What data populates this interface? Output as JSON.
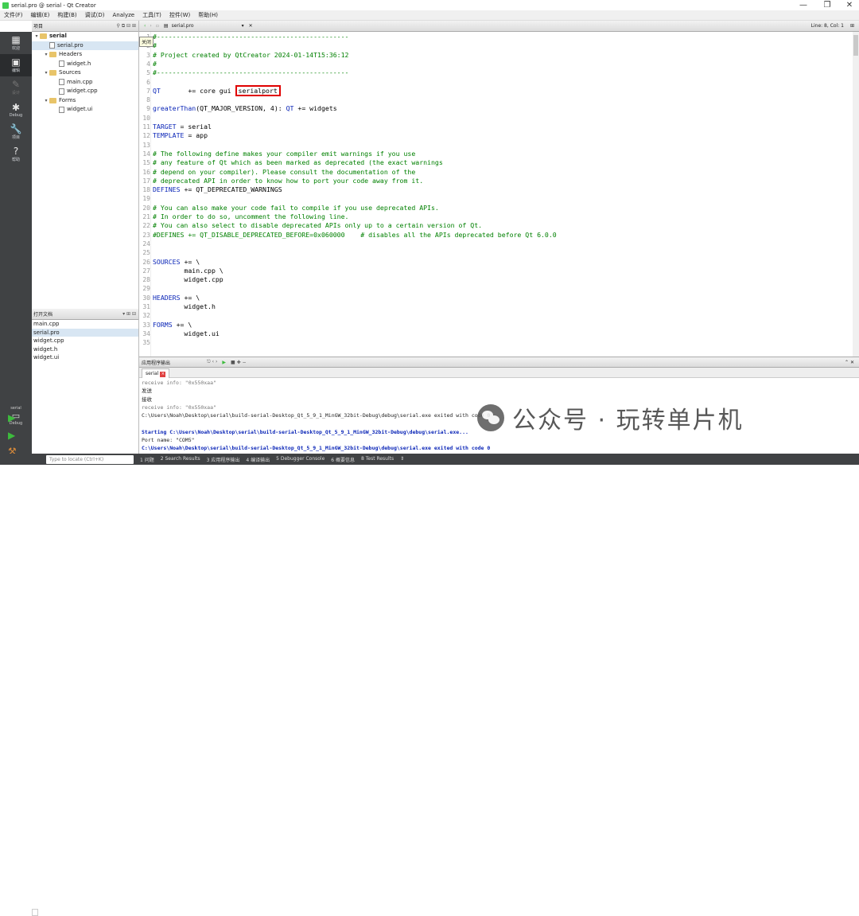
{
  "window": {
    "title": "serial.pro @ serial - Qt Creator",
    "minimize": "—",
    "restore": "❐",
    "close": "✕"
  },
  "menu": [
    "文件(F)",
    "编辑(E)",
    "构建(B)",
    "调试(D)",
    "Analyze",
    "工具(T)",
    "控件(W)",
    "帮助(H)"
  ],
  "modes": [
    {
      "icon": "▦",
      "label": "欢迎"
    },
    {
      "icon": "▣",
      "label": "编辑"
    },
    {
      "icon": "✎",
      "label": "设计"
    },
    {
      "icon": "✱",
      "label": "Debug"
    },
    {
      "icon": "🔧",
      "label": "项目"
    },
    {
      "icon": "?",
      "label": "帮助"
    }
  ],
  "kit": {
    "name": "serial",
    "label": "Debug"
  },
  "project_panel": {
    "header": "项目"
  },
  "tree": [
    {
      "label": "serial",
      "level": 0,
      "arrow": "▾",
      "folder": true,
      "bold": true
    },
    {
      "label": "serial.pro",
      "level": 1,
      "arrow": "",
      "folder": false,
      "selected": true
    },
    {
      "label": "Headers",
      "level": 1,
      "arrow": "▾",
      "folder": true
    },
    {
      "label": "widget.h",
      "level": 2,
      "arrow": "",
      "folder": false
    },
    {
      "label": "Sources",
      "level": 1,
      "arrow": "▾",
      "folder": true
    },
    {
      "label": "main.cpp",
      "level": 2,
      "arrow": "",
      "folder": false
    },
    {
      "label": "widget.cpp",
      "level": 2,
      "arrow": "",
      "folder": false
    },
    {
      "label": "Forms",
      "level": 1,
      "arrow": "▾",
      "folder": true
    },
    {
      "label": "widget.ui",
      "level": 2,
      "arrow": "",
      "folder": false
    }
  ],
  "open_docs": {
    "header": "打开文档",
    "items": [
      "main.cpp",
      "serial.pro",
      "widget.cpp",
      "widget.h",
      "widget.ui"
    ],
    "selected": 1
  },
  "editor": {
    "file_tab": "serial.pro",
    "cursor": "Line: 8, Col: 1",
    "tooltip": "关闭"
  },
  "code": [
    "#-------------------------------------------------",
    "#",
    "# Project created by QtCreator 2024-01-14T15:36:12",
    "#",
    "#-------------------------------------------------",
    "",
    "QT       += core gui serialport",
    "",
    "greaterThan(QT_MAJOR_VERSION, 4): QT += widgets",
    "",
    "TARGET = serial",
    "TEMPLATE = app",
    "",
    "# The following define makes your compiler emit warnings if you use",
    "# any feature of Qt which as been marked as deprecated (the exact warnings",
    "# depend on your compiler). Please consult the documentation of the",
    "# deprecated API in order to know how to port your code away from it.",
    "DEFINES += QT_DEPRECATED_WARNINGS",
    "",
    "# You can also make your code fail to compile if you use deprecated APIs.",
    "# In order to do so, uncomment the following line.",
    "# You can also select to disable deprecated APIs only up to a certain version of Qt.",
    "#DEFINES += QT_DISABLE_DEPRECATED_BEFORE=0x060000    # disables all the APIs deprecated before Qt 6.0.0",
    "",
    "",
    "SOURCES += \\",
    "        main.cpp \\",
    "        widget.cpp",
    "",
    "HEADERS += \\",
    "        widget.h",
    "",
    "FORMS += \\",
    "        widget.ui",
    ""
  ],
  "highlight_word": "serialport",
  "output_panel": {
    "header": "应用程序输出",
    "tab": "serial"
  },
  "output": [
    {
      "t": "receive info: \"0x550xaa\"",
      "c": "og"
    },
    {
      "t": "发送",
      "c": "ok"
    },
    {
      "t": "接收",
      "c": "ok"
    },
    {
      "t": "receive info: \"0x550xaa\"",
      "c": "og"
    },
    {
      "t": "C:\\Users\\Noah\\Desktop\\serial\\build-serial-Desktop_Qt_5_9_1_MinGW_32bit-Debug\\debug\\serial.exe exited with code 0",
      "c": "ok"
    },
    {
      "t": "",
      "c": "ok"
    },
    {
      "t": "Starting C:\\Users\\Noah\\Desktop\\serial\\build-serial-Desktop_Qt_5_9_1_MinGW_32bit-Debug\\debug\\serial.exe...",
      "c": "ob"
    },
    {
      "t": "Port name: \"COM5\"",
      "c": "ok"
    },
    {
      "t": "C:\\Users\\Noah\\Desktop\\serial\\build-serial-Desktop_Qt_5_9_1_MinGW_32bit-Debug\\debug\\serial.exe exited with code 0",
      "c": "ob"
    }
  ],
  "watermark": "公众号 · 玩转单片机",
  "status": {
    "locate_placeholder": "Type to locate (Ctrl+K)",
    "panes": [
      "1 问题",
      "2 Search Results",
      "3 应用程序输出",
      "4 编译输出",
      "5 Debugger Console",
      "6 概要信息",
      "8 Test Results",
      "⇕"
    ]
  },
  "colors": {
    "keyword": "#0a25b7",
    "comment": "#008000",
    "highlight_box": "#e00000",
    "sidebar": "#404244"
  }
}
